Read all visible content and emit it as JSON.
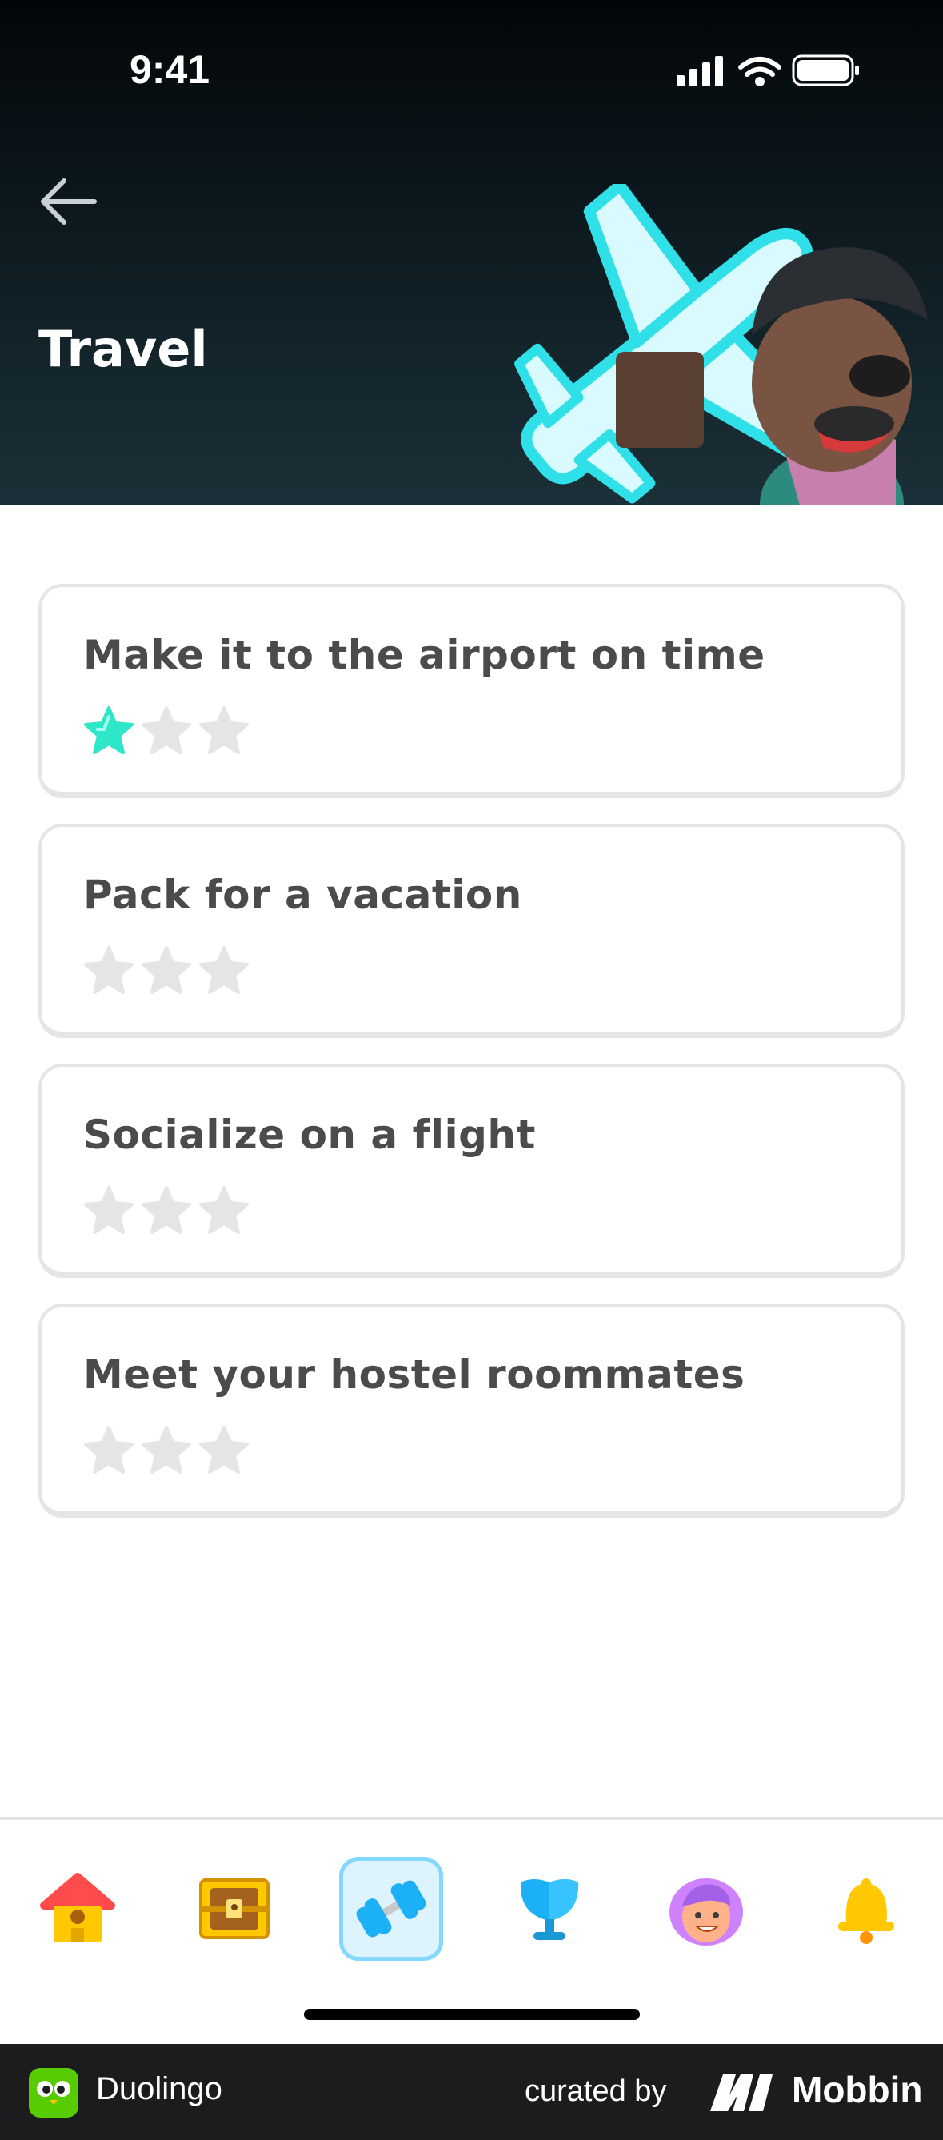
{
  "status_bar": {
    "time": "9:41"
  },
  "header": {
    "title": "Travel"
  },
  "topics": [
    {
      "title": "Make it to the airport on time",
      "stars_earned": 1,
      "stars_total": 3
    },
    {
      "title": "Pack for a vacation",
      "stars_earned": 0,
      "stars_total": 3
    },
    {
      "title": "Socialize on a flight",
      "stars_earned": 0,
      "stars_total": 3
    },
    {
      "title": "Meet your hostel roommates",
      "stars_earned": 0,
      "stars_total": 3
    }
  ],
  "tabbar": {
    "items": [
      {
        "icon": "home-icon",
        "active": false
      },
      {
        "icon": "treasure-chest-icon",
        "active": false
      },
      {
        "icon": "dumbbell-icon",
        "active": true
      },
      {
        "icon": "trophy-icon",
        "active": false
      },
      {
        "icon": "profile-avatar-icon",
        "active": false
      },
      {
        "icon": "bell-icon",
        "active": false
      }
    ]
  },
  "footer": {
    "app_name": "Duolingo",
    "curated_by": "curated by",
    "brand": "Mobbin"
  },
  "colors": {
    "star_active": "#2ee6c8",
    "star_inactive": "#e5e5e5",
    "text": "#4b4b4b",
    "tab_active_bg": "#ddf4ff",
    "tab_active_border": "#84d8ff"
  }
}
